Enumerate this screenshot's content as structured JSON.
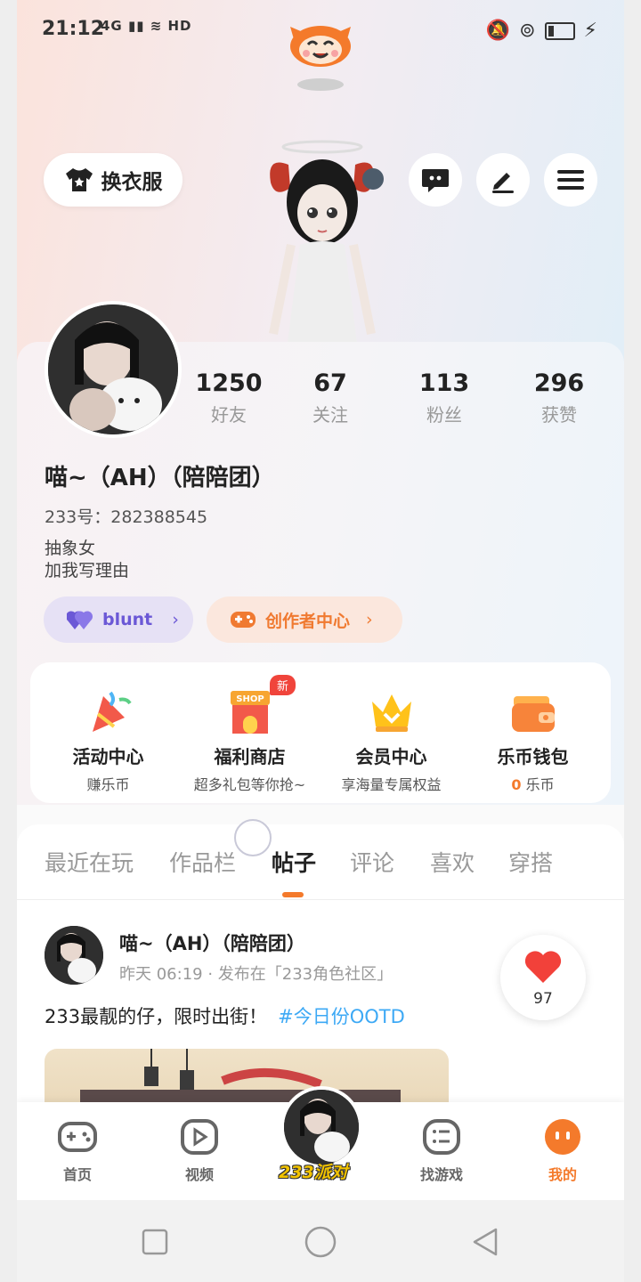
{
  "status_bar": {
    "time": "21:12",
    "signal": "4G",
    "hd": "HD"
  },
  "header": {
    "wardrobe_label": "换衣服"
  },
  "profile": {
    "stats": [
      {
        "value": "1250",
        "label": "好友"
      },
      {
        "value": "67",
        "label": "关注"
      },
      {
        "value": "113",
        "label": "粉丝"
      },
      {
        "value": "296",
        "label": "获赞"
      }
    ],
    "name": "喵~（AH）（陪陪团）",
    "id_line": "233号：282388545",
    "bio_line1": "抽象女",
    "bio_line2": "加我写理由",
    "tag_blunt": "blunt",
    "tag_creator": "创作者中心"
  },
  "services": [
    {
      "title": "活动中心",
      "subtitle": "赚乐币"
    },
    {
      "title": "福利商店",
      "subtitle": "超多礼包等你抢~",
      "badge": "新",
      "icon_text": "SHOP"
    },
    {
      "title": "会员中心",
      "subtitle": "享海量专属权益"
    },
    {
      "title": "乐币钱包",
      "amount": "0",
      "unit": "乐币"
    }
  ],
  "tabs": [
    "最近在玩",
    "作品栏",
    "帖子",
    "评论",
    "喜欢",
    "穿搭"
  ],
  "active_tab": "帖子",
  "post": {
    "author": "喵~（AH）（陪陪团）",
    "meta": "昨天 06:19 · 发布在「233角色社区」",
    "text": "233最靓的仔，限时出街！",
    "hashtag": "#今日份OOTD",
    "likes": "97"
  },
  "bottom_nav": {
    "home": "首页",
    "video": "视频",
    "center": "233派对",
    "find_games": "找游戏",
    "mine": "我的"
  },
  "colors": {
    "accent": "#f47a2b",
    "hashtag": "#3da9f5",
    "blunt": "#6b58d6",
    "badge": "#f0443b"
  }
}
